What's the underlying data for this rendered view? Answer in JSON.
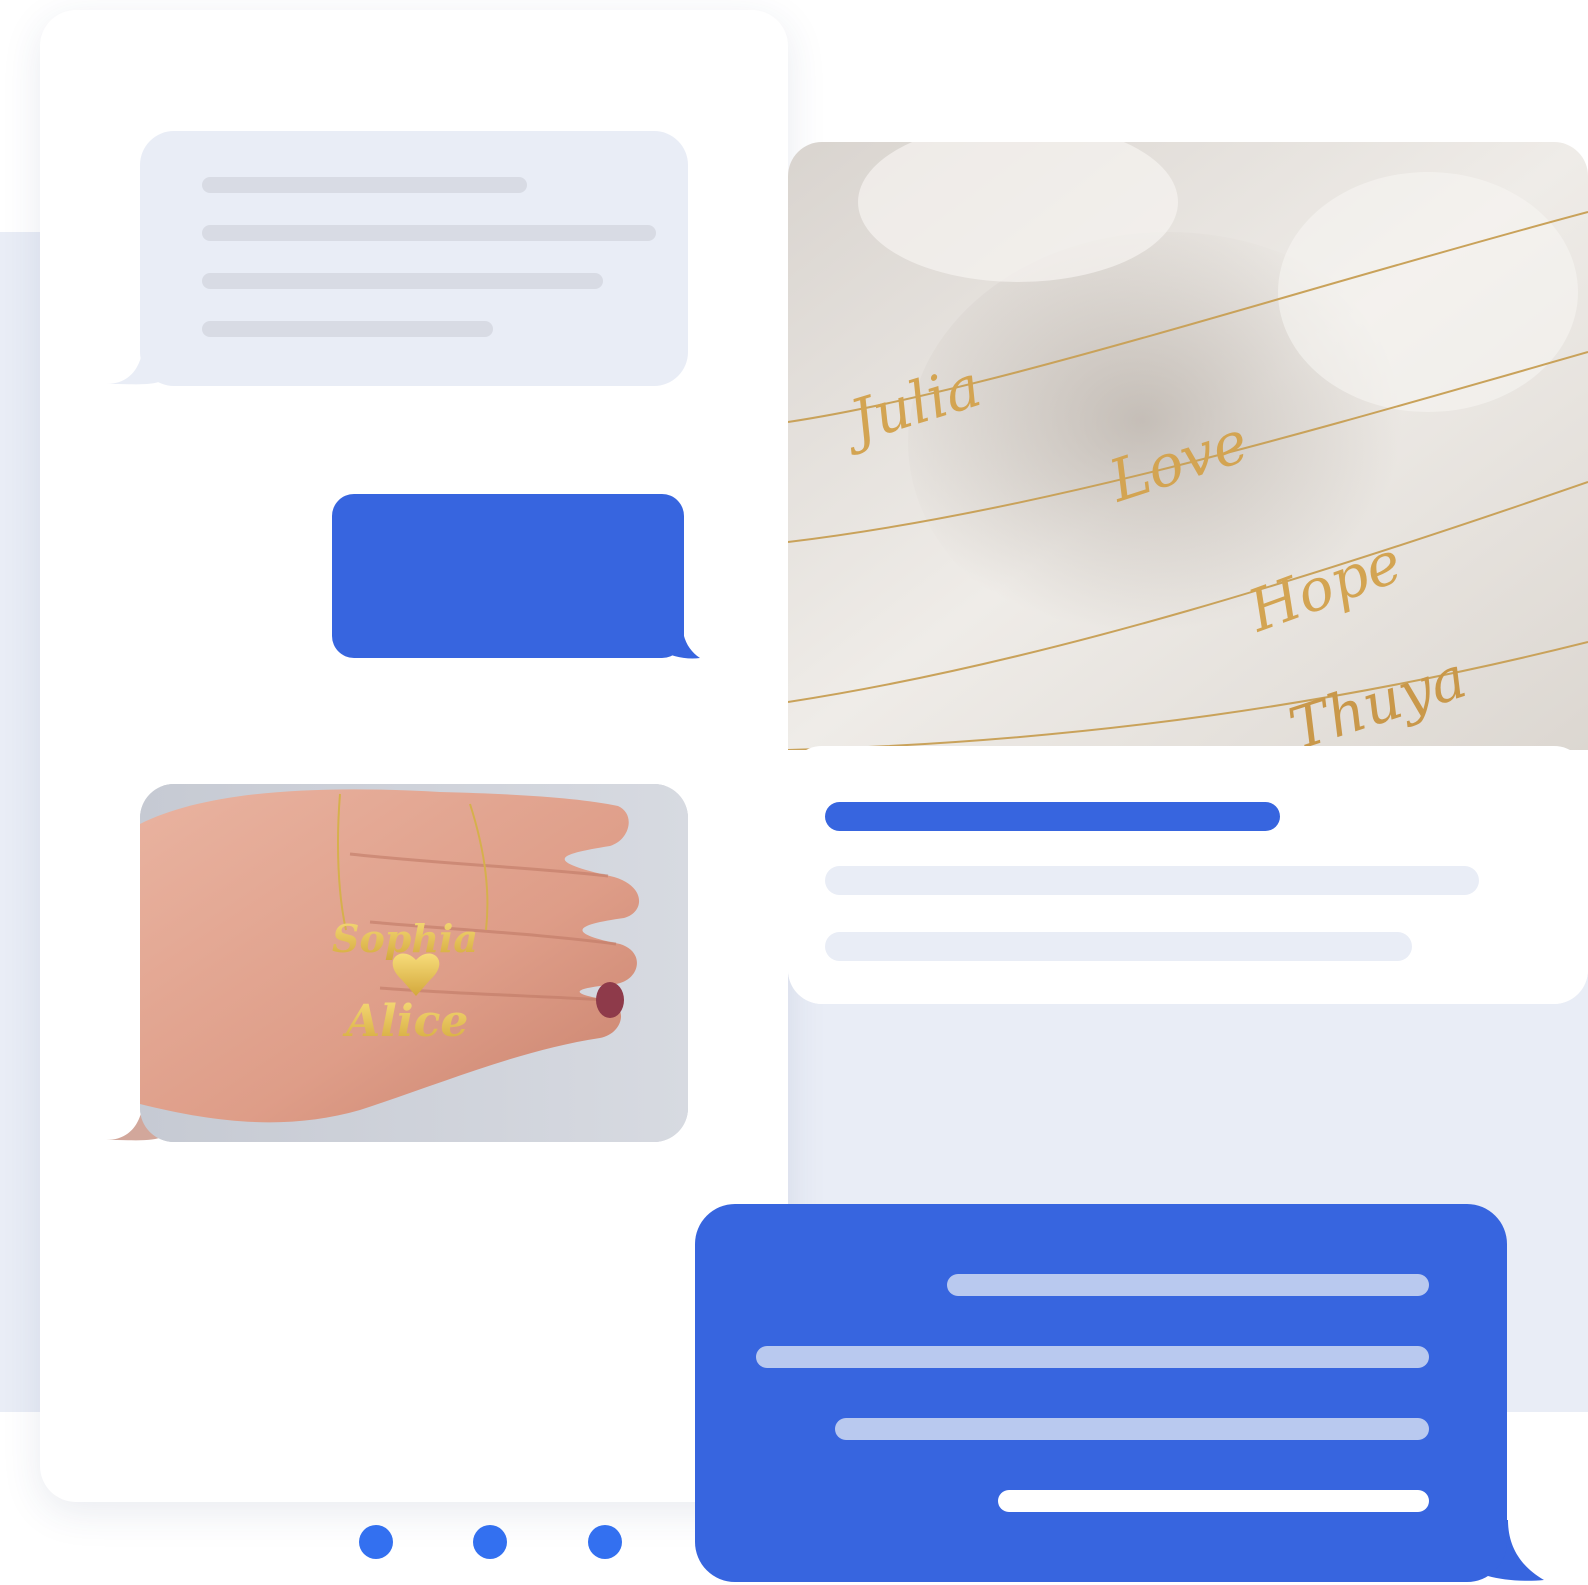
{
  "colors": {
    "accent": "#3765df",
    "dot": "#3370f0",
    "incoming_bubble": "#e9edf6",
    "placeholder_line": "#d8dbe4",
    "background_band": "#e9edf6"
  },
  "chat": {
    "incoming_message": {
      "placeholder_lines": 4
    },
    "outgoing_message": {
      "content": ""
    },
    "photo_message": {
      "image_alt": "hand wearing gold name necklace",
      "necklace_text_1": "Sophia",
      "necklace_text_2": "Alice"
    },
    "typing_indicator": {
      "dots": 3
    }
  },
  "product_card": {
    "image_alt": "gold script name necklaces on white fabric",
    "necklace_names": [
      "Julia",
      "Love",
      "Hope",
      "Thuya"
    ]
  },
  "reply_message": {
    "placeholder_lines": 4
  },
  "icons": [
    "typing-dot",
    "chat-bubble-tail"
  ]
}
